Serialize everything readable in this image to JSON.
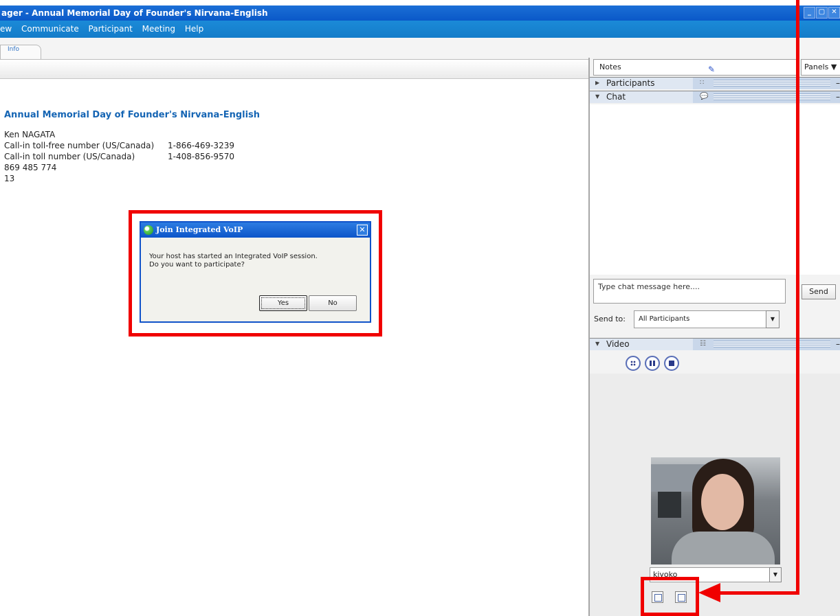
{
  "window": {
    "title": "ager - Annual Memorial Day of Founder's Nirvana-English"
  },
  "menu": {
    "items": [
      "ew",
      "Communicate",
      "Participant",
      "Meeting",
      "Help"
    ]
  },
  "tabs": [
    {
      "label": "Info"
    }
  ],
  "info": {
    "heading": "Annual Memorial Day of Founder's Nirvana-English",
    "host": "Ken NAGATA",
    "tollfree_label": "Call-in toll-free number (US/Canada)",
    "tollfree_number": "1-866-469-3239",
    "toll_label": "Call-in toll number (US/Canada)",
    "toll_number": "1-408-856-9570",
    "meeting_number": "869 485 774",
    "attendee_id": "13"
  },
  "dialog": {
    "title": "Join Integrated VoIP",
    "message_line1": "Your host has started an Integrated VoIP session.",
    "message_line2": "Do you want to participate?",
    "yes_label": "Yes",
    "no_label": "No"
  },
  "right_panel": {
    "notes_label": "Notes",
    "panels_label": "Panels",
    "participants_label": "Participants",
    "chat_label": "Chat",
    "chat_placeholder": "Type chat message here....",
    "send_label": "Send",
    "send_to_label": "Send to:",
    "send_to_value": "All Participants",
    "video_label": "Video",
    "video_user": "kiyoko"
  },
  "accent_colors": {
    "annotation_red": "#f00000",
    "title_blue": "#0a58c8",
    "heading_blue": "#1565b4"
  }
}
